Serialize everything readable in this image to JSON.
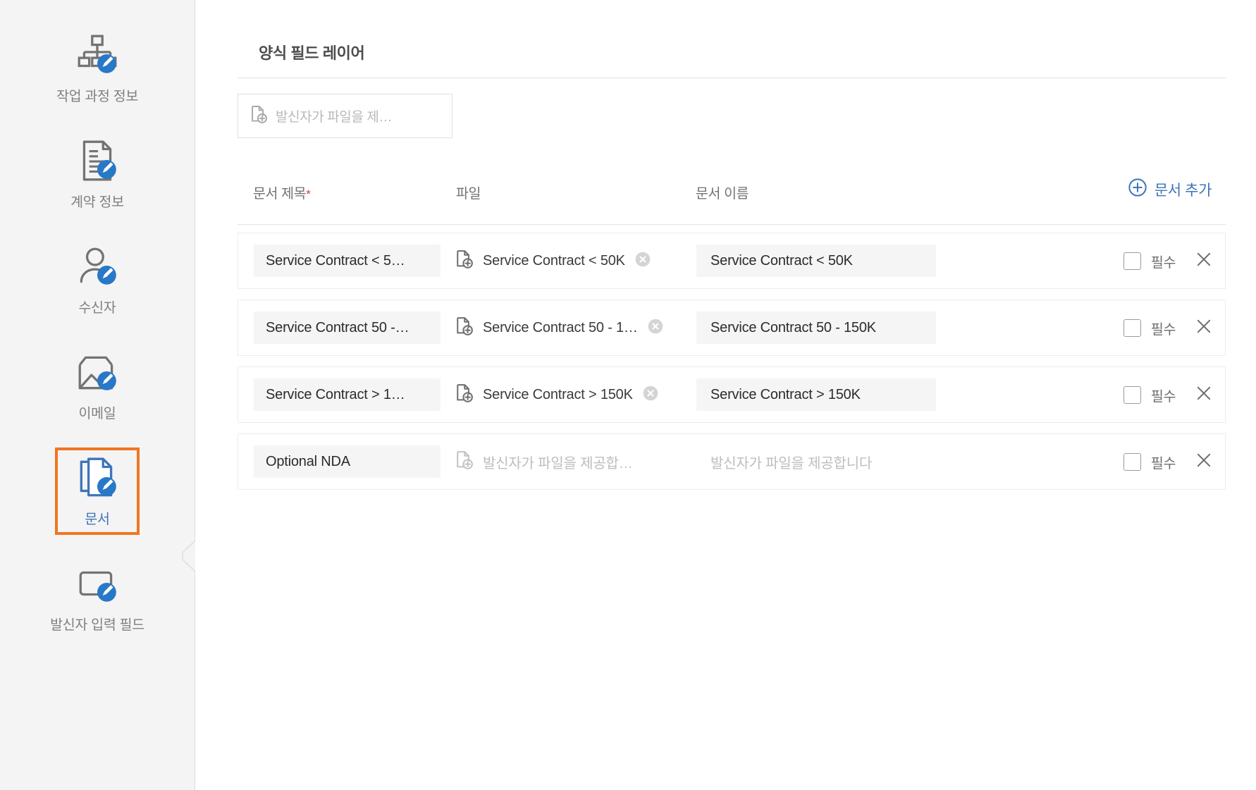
{
  "sidebar": {
    "items": [
      {
        "label": "작업 과정 정보",
        "icon": "workflow-info-icon",
        "active": false
      },
      {
        "label": "계약 정보",
        "icon": "contract-info-icon",
        "active": false
      },
      {
        "label": "수신자",
        "icon": "recipient-icon",
        "active": false
      },
      {
        "label": "이메일",
        "icon": "email-icon",
        "active": false
      },
      {
        "label": "문서",
        "icon": "documents-icon",
        "active": true
      },
      {
        "label": "발신자 입력 필드",
        "icon": "sender-input-field-icon",
        "active": false
      }
    ],
    "collapse_handle_icon": "chevron-left-icon"
  },
  "main": {
    "section_title": "양식 필드 레이어",
    "layer_picker": {
      "icon": "file-add-icon",
      "placeholder": "발신자가 파일을 제…"
    },
    "table": {
      "headers": {
        "doc_title": "문서 제목",
        "doc_title_required_marker": "*",
        "file": "파일",
        "doc_name": "문서 이름"
      },
      "add_button": {
        "label": "문서 추가",
        "icon": "plus-circle-icon"
      },
      "row_controls": {
        "required_label": "필수",
        "remove_icon": "close-icon",
        "checkbox_icon": "checkbox-unchecked-icon",
        "file_icon": "file-add-icon",
        "clear_file_icon": "clear-circle-icon"
      },
      "rows": [
        {
          "doc_title": "Service Contract  < 5…",
          "file_name": "Service Contract < 50K",
          "file_empty": false,
          "doc_name": "Service Contract  <  50K",
          "doc_name_empty": false,
          "required_checked": false
        },
        {
          "doc_title": "Service Contract 50 -…",
          "file_name": "Service Contract 50 - 1…",
          "file_empty": false,
          "doc_name": "Service Contract 50 - 150K",
          "doc_name_empty": false,
          "required_checked": false
        },
        {
          "doc_title": "Service Contract  > 1…",
          "file_name": "Service Contract > 150K",
          "file_empty": false,
          "doc_name": "Service Contract  >  150K",
          "doc_name_empty": false,
          "required_checked": false
        },
        {
          "doc_title": "Optional NDA",
          "file_name": "발신자가 파일을 제공합…",
          "file_empty": true,
          "doc_name": "발신자가 파일을 제공합니다",
          "doc_name_empty": true,
          "required_checked": false
        }
      ]
    }
  },
  "colors": {
    "accent_blue": "#3e74b8",
    "active_orange": "#ef7622",
    "required_red": "#e8352b",
    "sidebar_bg": "#f4f4f4",
    "field_bg": "#f5f5f5"
  }
}
